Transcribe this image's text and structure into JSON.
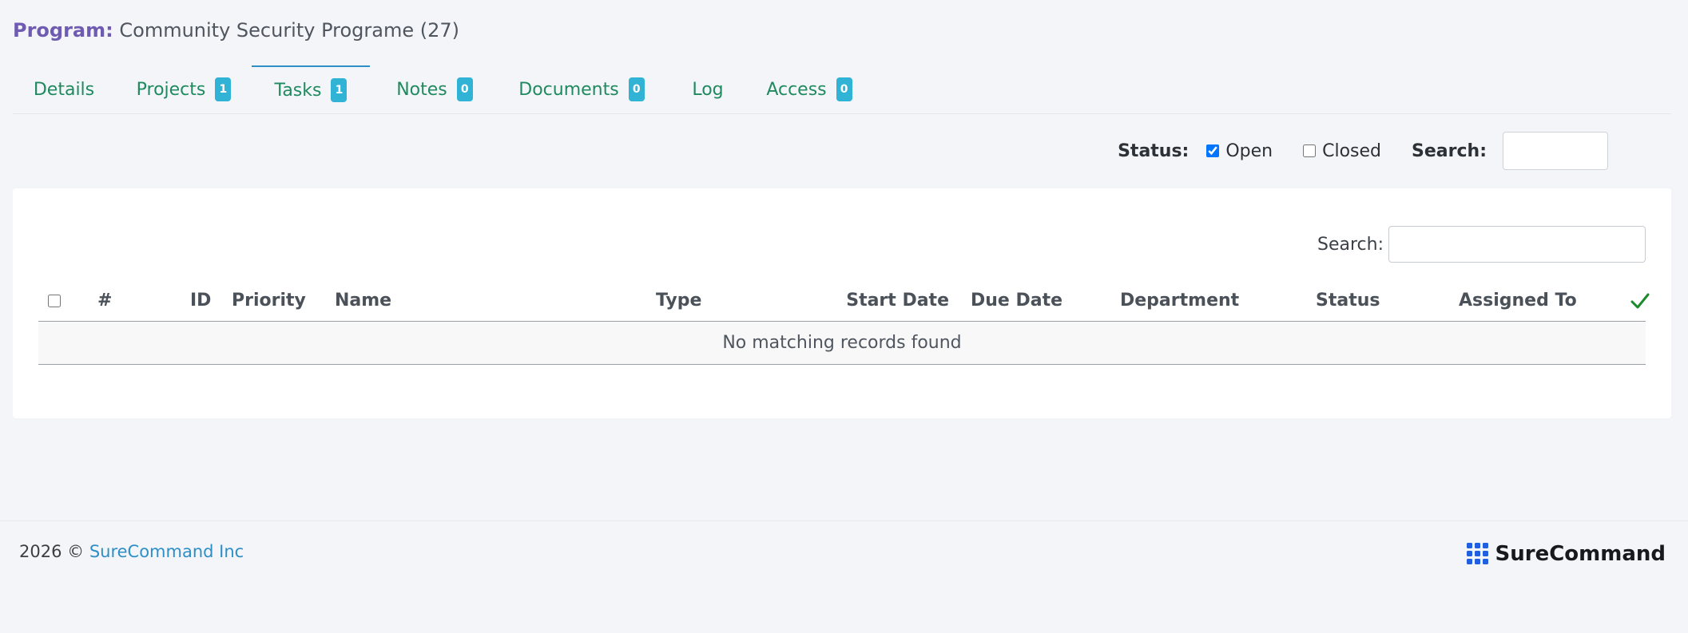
{
  "program": {
    "label": "Program:",
    "name": "Community Security Programe (27)"
  },
  "tabs": [
    {
      "label": "Details",
      "badge": null
    },
    {
      "label": "Projects",
      "badge": "1"
    },
    {
      "label": "Tasks",
      "badge": "1",
      "active": true
    },
    {
      "label": "Notes",
      "badge": "0"
    },
    {
      "label": "Documents",
      "badge": "0"
    },
    {
      "label": "Log",
      "badge": null
    },
    {
      "label": "Access",
      "badge": "0"
    }
  ],
  "filters": {
    "status_label": "Status:",
    "open_label": "Open",
    "open_checked": true,
    "closed_label": "Closed",
    "closed_checked": false,
    "search_label": "Search:",
    "search_value": ""
  },
  "table": {
    "search_label": "Search:",
    "search_value": "",
    "columns": [
      "#",
      "ID",
      "Priority",
      "Name",
      "Type",
      "Start Date",
      "Due Date",
      "Department",
      "Status",
      "Assigned To"
    ],
    "empty_message": "No matching records found"
  },
  "footer": {
    "copyright": "2026 ©",
    "company_link": "SureCommand Inc",
    "brand": "SureCommand"
  },
  "colors": {
    "accent_purple": "#6f5bb1",
    "tab_green": "#1f8a5f",
    "badge_blue": "#31b3d6",
    "link_blue": "#2e8fc7",
    "check_green": "#1e8a2e",
    "logo_blue": "#1f5fe0"
  }
}
